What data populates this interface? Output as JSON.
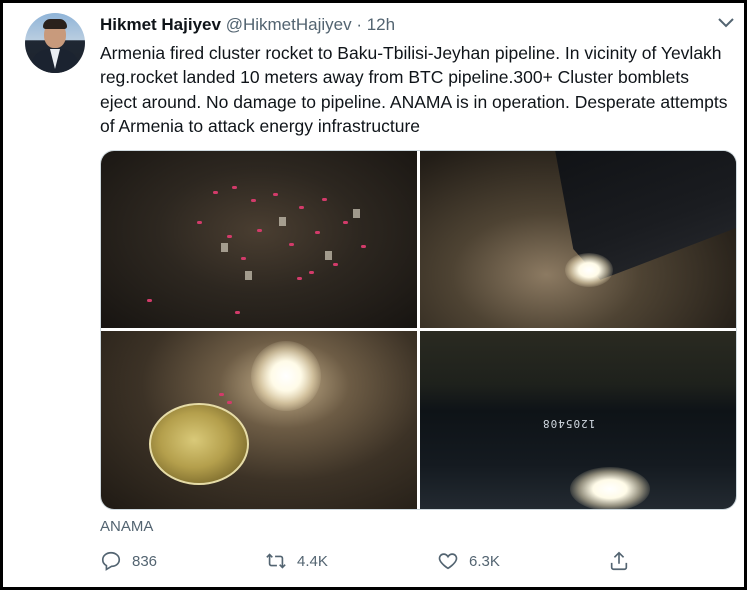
{
  "author": {
    "name": "Hikmet Hajiyev",
    "handle": "@HikmetHajiyev",
    "separator": "·",
    "time": "12h"
  },
  "tweet": {
    "text": "Armenia fired cluster rocket to Baku-Tbilisi-Jeyhan pipeline. In vicinity of Yevlakh reg.rocket landed 10 meters away from BTC pipeline.300+ Cluster bomblets eject around. No damage to pipeline. ANAMA is in operation. Desperate attempts of Armenia to attack energy infrastructure"
  },
  "media": {
    "photos": [
      "bomblets-on-ground",
      "rocket-debris",
      "rocket-disc-fragment",
      "pipeline-surface"
    ],
    "pipe_marking": "1205408"
  },
  "caption": "ANAMA",
  "actions": {
    "reply_count": "836",
    "retweet_count": "4.4K",
    "like_count": "6.3K"
  },
  "icons": {
    "more": "chevron-down-icon",
    "reply": "reply-icon",
    "retweet": "retweet-icon",
    "like": "heart-icon",
    "share": "share-icon"
  },
  "colors": {
    "text": "#0f1419",
    "secondary": "#536471",
    "frame": "#000000"
  }
}
